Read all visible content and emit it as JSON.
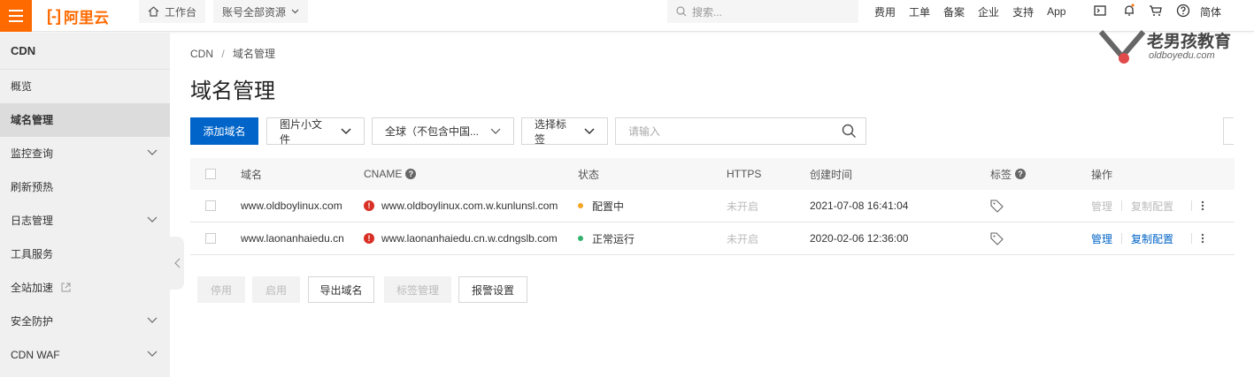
{
  "topbar": {
    "logo_mark": "[-]",
    "logo_text": "阿里云",
    "workbench": "工作台",
    "resources": "账号全部资源",
    "search_placeholder": "搜索...",
    "links": [
      "费用",
      "工单",
      "备案",
      "企业",
      "支持",
      "App"
    ],
    "language": "简体",
    "accent_color": "#ff6a00"
  },
  "watermark": {
    "title": "老男孩教育",
    "subtitle": "oldboyedu.com"
  },
  "sidebar": {
    "title": "CDN",
    "items": [
      {
        "label": "概览"
      },
      {
        "label": "域名管理"
      },
      {
        "label": "监控查询"
      },
      {
        "label": "刷新预热"
      },
      {
        "label": "日志管理"
      },
      {
        "label": "工具服务"
      },
      {
        "label": "全站加速"
      },
      {
        "label": "安全防护"
      },
      {
        "label": "CDN WAF"
      }
    ]
  },
  "main": {
    "breadcrumb": {
      "root": "CDN",
      "sep": "/",
      "current": "域名管理"
    },
    "title": "域名管理",
    "toolbar": {
      "add_label": "添加域名",
      "type_select": "图片小文件",
      "region_select": "全球（不包含中国...",
      "tag_select": "选择标签",
      "input_placeholder": "请输入"
    },
    "table": {
      "headers": {
        "domain": "域名",
        "cname": "CNAME",
        "status": "状态",
        "https": "HTTPS",
        "created": "创建时间",
        "tags": "标签",
        "actions": "操作"
      },
      "rows": [
        {
          "domain": "www.oldboylinux.com",
          "cname": "www.oldboylinux.com.w.kunlunsl.com",
          "status": "配置中",
          "status_color": "#f5a623",
          "https": "未开启",
          "created": "2021-07-08 16:41:04",
          "manage": "管理",
          "copy": "复制配置"
        },
        {
          "domain": "www.laonanhaiedu.cn",
          "cname": "www.laonanhaiedu.cn.w.cdngslb.com",
          "status": "正常运行",
          "status_color": "#32b16c",
          "https": "未开启",
          "created": "2020-02-06 12:36:00",
          "manage": "管理",
          "copy": "复制配置"
        }
      ]
    },
    "bottom_buttons": {
      "stop": "停用",
      "enable": "启用",
      "export": "导出域名",
      "tag_manage": "标签管理",
      "alarm": "报警设置"
    }
  }
}
